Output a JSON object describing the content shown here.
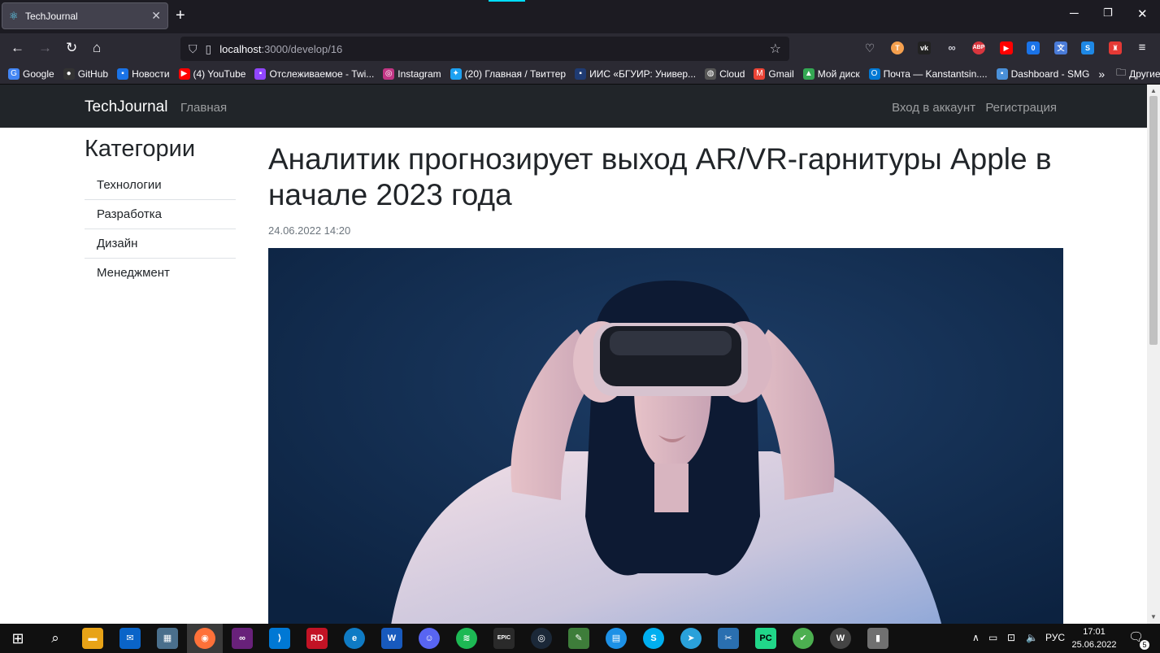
{
  "browser": {
    "tab_title": "TechJournal",
    "new_tab": "+",
    "url_host": "localhost",
    "url_path": ":3000/develop/16",
    "bookmarks": [
      {
        "label": "Google",
        "color": "#4285f4",
        "icon": "G"
      },
      {
        "label": "GitHub",
        "color": "#333333",
        "icon": "●"
      },
      {
        "label": "Новости",
        "color": "#1a73e8",
        "icon": "▪"
      },
      {
        "label": "(4) YouTube",
        "color": "#ff0000",
        "icon": "▶"
      },
      {
        "label": "Отслеживаемое - Twi...",
        "color": "#9146ff",
        "icon": "▪"
      },
      {
        "label": "Instagram",
        "color": "#c13584",
        "icon": "◎"
      },
      {
        "label": "(20) Главная / Твиттер",
        "color": "#1da1f2",
        "icon": "✦"
      },
      {
        "label": "ИИС «БГУИР: Универ...",
        "color": "#1f3b73",
        "icon": "▪"
      },
      {
        "label": "Cloud",
        "color": "#555555",
        "icon": "◍"
      },
      {
        "label": "Gmail",
        "color": "#ea4335",
        "icon": "M"
      },
      {
        "label": "Мой диск",
        "color": "#34a853",
        "icon": "▲"
      },
      {
        "label": "Почта — Kanstantsin....",
        "color": "#0078d4",
        "icon": "O"
      },
      {
        "label": "Dashboard - SMG",
        "color": "#4a90d9",
        "icon": "▪"
      }
    ],
    "other_bookmarks": "Другие закладки"
  },
  "site": {
    "brand": "TechJournal",
    "nav_home": "Главная",
    "nav_login": "Вход в аккаунт",
    "nav_register": "Регистрация"
  },
  "sidebar": {
    "title": "Категории",
    "items": [
      "Технологии",
      "Разработка",
      "Дизайн",
      "Менеджмент"
    ]
  },
  "article": {
    "title": "Аналитик прогнозирует выход AR/VR-гарнитуры Apple в начале 2023 года",
    "date": "24.06.2022 14:20"
  },
  "taskbar": {
    "lang": "РУС",
    "time": "17:01",
    "date": "25.06.2022",
    "notifications": "5"
  }
}
